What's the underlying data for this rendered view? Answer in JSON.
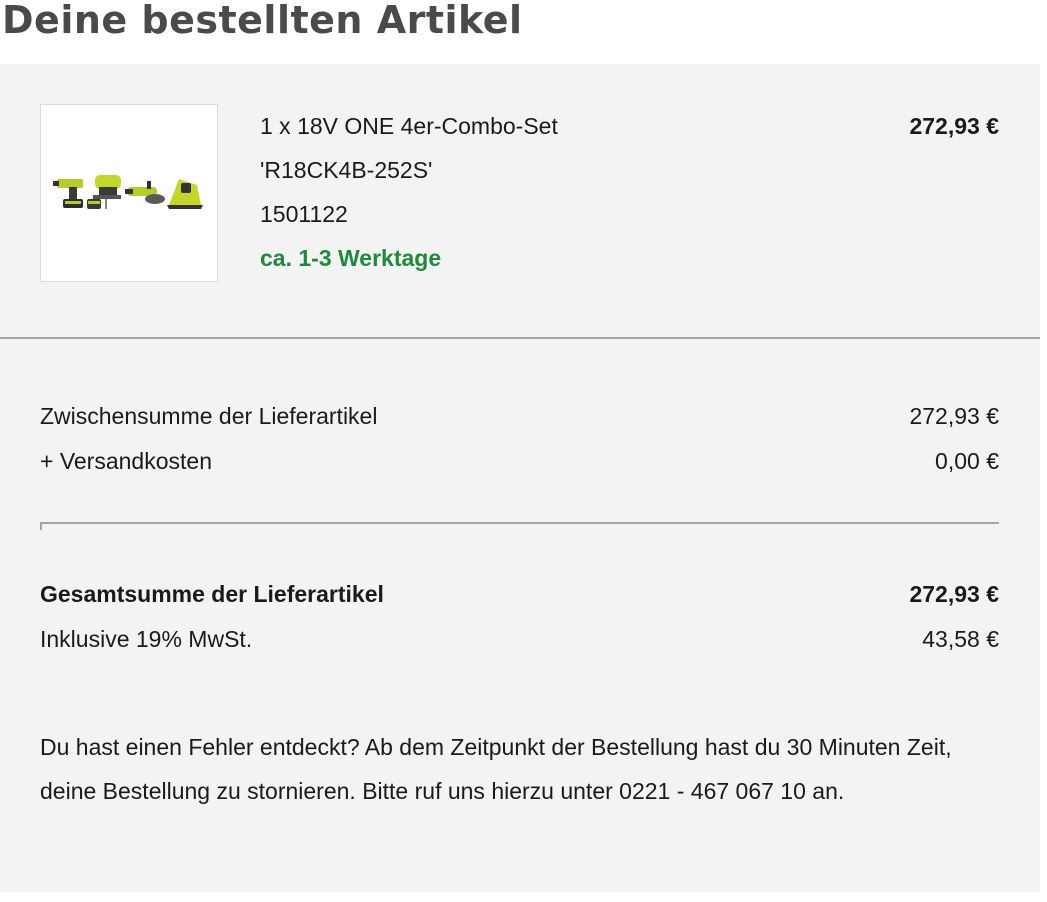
{
  "page": {
    "title": "Deine bestellten Artikel"
  },
  "item": {
    "image_icon": "product-tools-set-image",
    "name": "1 x 18V ONE 4er-Combo-Set",
    "code": "'R18CK4B-252S'",
    "number": "1501122",
    "delivery": "ca. 1-3 Werktage",
    "price": "272,93 €"
  },
  "summary": {
    "subtotal_label": "Zwischensumme der Lieferartikel",
    "subtotal_value": "272,93 €",
    "shipping_label": "+ Versandkosten",
    "shipping_value": "0,00 €",
    "total_label": "Gesamtsumme der Lieferartikel",
    "total_value": "272,93 €",
    "vat_label": "Inklusive 19% MwSt.",
    "vat_value": "43,58 €"
  },
  "info": {
    "text": "Du hast einen Fehler entdeckt? Ab dem Zeitpunkt der Bestellung hast du 30 Minuten Zeit, deine Bestellung zu stornieren. Bitte ruf uns hierzu unter 0221 - 467 067 10 an."
  },
  "colors": {
    "delivery_green": "#1f8a3c",
    "panel_background": "#f3f3f3",
    "title_gray": "#4a4a4a"
  }
}
